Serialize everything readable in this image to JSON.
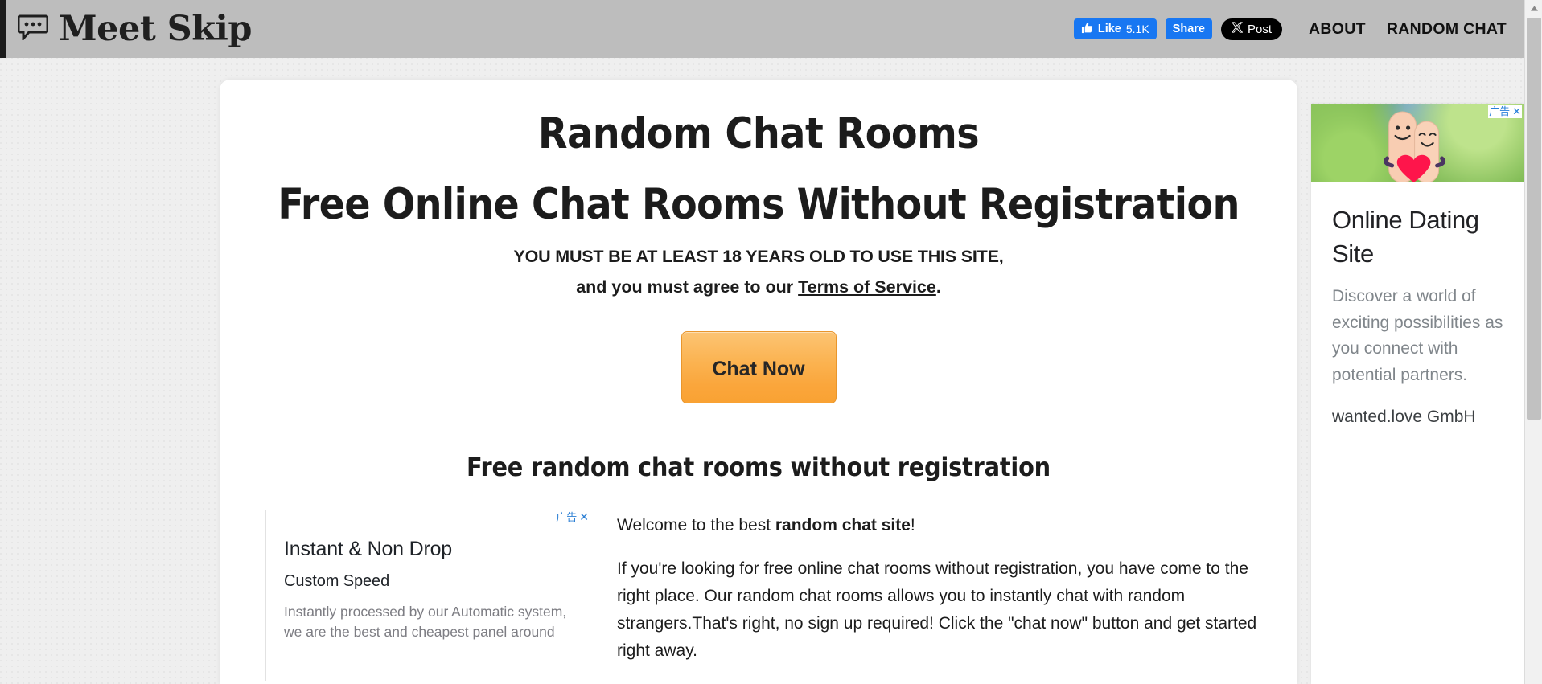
{
  "header": {
    "logo_icon": "speech-bubble-icon",
    "brand": "Meet Skip",
    "facebook": {
      "like_label": "Like",
      "like_count": "5.1K",
      "share_label": "Share",
      "thumb_icon": "thumbs-up-icon"
    },
    "twitter": {
      "post_label": "Post",
      "logo_icon": "x-logo-icon"
    },
    "nav": [
      {
        "label": "ABOUT"
      },
      {
        "label": "RANDOM CHAT"
      }
    ]
  },
  "main": {
    "title": "Random Chat Rooms",
    "subtitle": "Free Online Chat Rooms Without Registration",
    "age_warning": "YOU MUST BE AT LEAST 18 YEARS OLD TO USE THIS SITE,",
    "agree_prefix": "and you must agree to our ",
    "terms_link": "Terms of Service",
    "agree_suffix": ".",
    "cta_label": "Chat Now",
    "section_heading": "Free random chat rooms without registration",
    "article": {
      "p1_prefix": "Welcome to the best ",
      "p1_bold": "random chat site",
      "p1_suffix": "!",
      "p2": "If you're looking for free online chat rooms without registration, you have come to the right place. Our random chat rooms allows you to instantly chat with random strangers.That's right, no sign up required! Click the \"chat now\" button and get started right away."
    }
  },
  "inline_ad": {
    "ad_label": "广告",
    "close_glyph": "✕",
    "title": "Instant & Non Drop",
    "subtitle": "Custom Speed",
    "body": "Instantly processed by our Automatic system, we are the best and cheapest panel around"
  },
  "side_ad": {
    "ad_label": "广告",
    "close_glyph": "✕",
    "image_alt": "two-fingers-with-heart-image",
    "title": "Online Dating Site",
    "body": "Discover a world of exciting possibilities as you connect with potential partners.",
    "advertiser": "wanted.love GmbH"
  },
  "scrollbar": {
    "up_arrow": "▲"
  },
  "colors": {
    "header_bg": "#bdbdbd",
    "page_bg": "#efefef",
    "card_bg": "#ffffff",
    "cta_orange": "#faa63c",
    "facebook_blue": "#1877f2",
    "x_black": "#000000",
    "ad_label_blue": "#2b7fd4"
  }
}
